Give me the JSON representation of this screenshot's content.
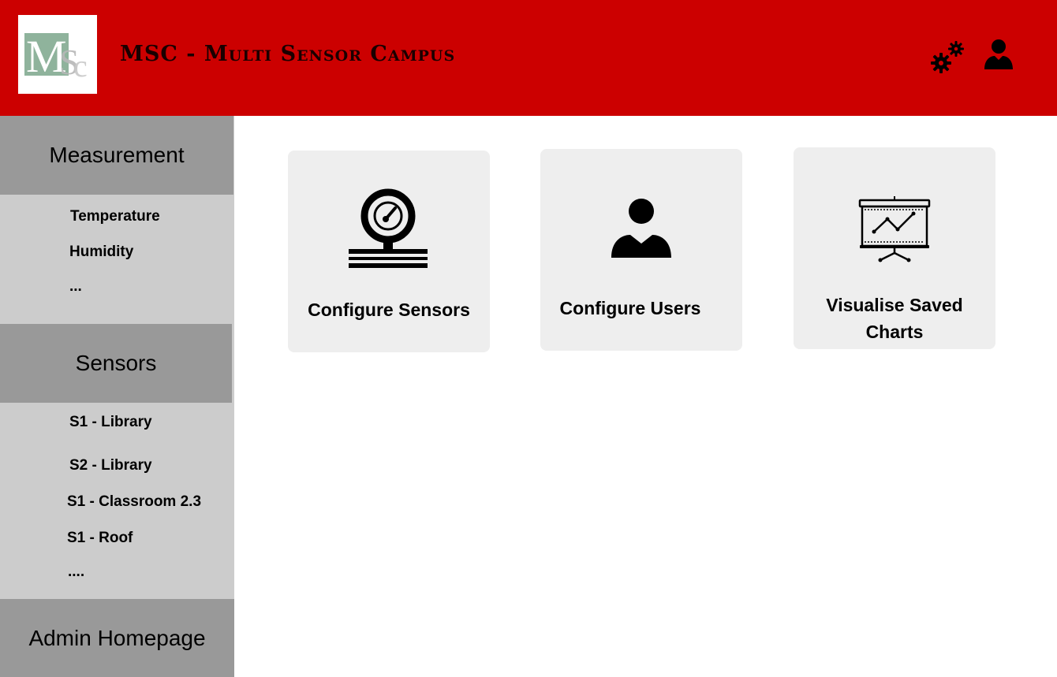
{
  "header": {
    "logo_text": "MSc",
    "title": "MSC - Multi Sensor Campus",
    "settings_icon": "gears-icon",
    "profile_icon": "user-icon",
    "background_color": "#cc0000"
  },
  "sidebar": {
    "sections": [
      {
        "title": "Measurement",
        "items": [
          "Temperature",
          "Humidity",
          "..."
        ]
      },
      {
        "title": "Sensors",
        "items": [
          "S1 - Library",
          "S2 - Library",
          "S1 - Classroom 2.3",
          "S1 - Roof",
          "...."
        ]
      },
      {
        "title": "Admin Homepage",
        "items": []
      }
    ],
    "header_color": "#999999",
    "body_color": "#cccccc"
  },
  "cards": [
    {
      "label": "Configure Sensors",
      "icon": "pressure-gauge-icon"
    },
    {
      "label": "Configure Users",
      "icon": "user-icon"
    },
    {
      "label_line1": "Visualise Saved",
      "label_line2": "Charts",
      "icon": "presentation-chart-icon"
    }
  ]
}
